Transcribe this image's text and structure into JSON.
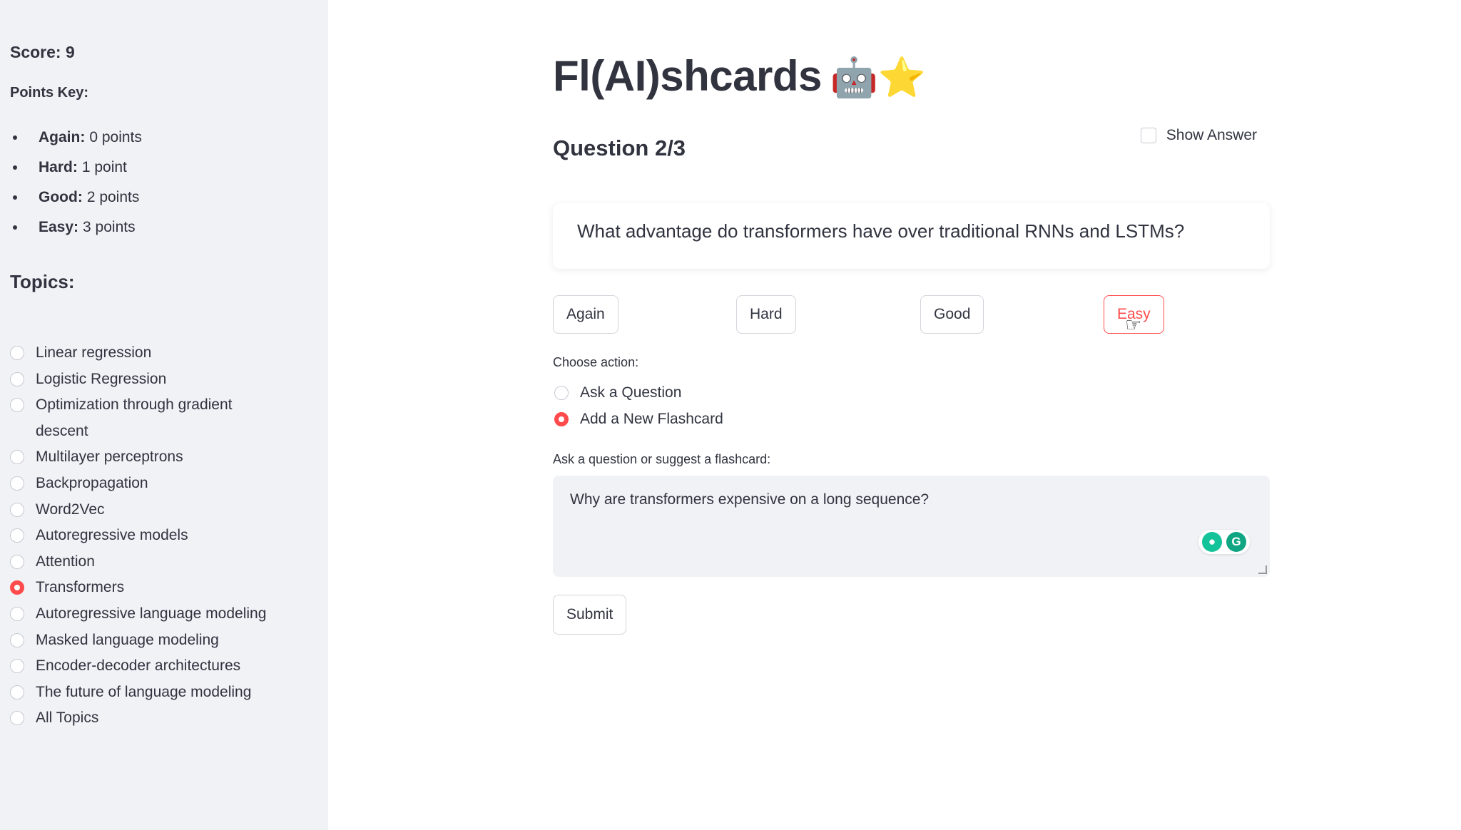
{
  "sidebar": {
    "score": "Score: 9",
    "points_key_title": "Points Key:",
    "points_key": [
      {
        "name": "Again:",
        "value": "0 points"
      },
      {
        "name": "Hard:",
        "value": "1 point"
      },
      {
        "name": "Good:",
        "value": "2 points"
      },
      {
        "name": "Easy:",
        "value": "3 points"
      }
    ],
    "topics_title": "Topics:",
    "topics": [
      {
        "label": "Linear regression",
        "selected": false
      },
      {
        "label": "Logistic Regression",
        "selected": false
      },
      {
        "label": "Optimization through gradient descent",
        "selected": false
      },
      {
        "label": "Multilayer perceptrons",
        "selected": false
      },
      {
        "label": "Backpropagation",
        "selected": false
      },
      {
        "label": "Word2Vec",
        "selected": false
      },
      {
        "label": "Autoregressive models",
        "selected": false
      },
      {
        "label": "Attention",
        "selected": false
      },
      {
        "label": "Transformers",
        "selected": true
      },
      {
        "label": "Autoregressive language modeling",
        "selected": false
      },
      {
        "label": "Masked language modeling",
        "selected": false
      },
      {
        "label": "Encoder-decoder architectures",
        "selected": false
      },
      {
        "label": "The future of language modeling",
        "selected": false
      },
      {
        "label": "All Topics",
        "selected": false
      }
    ]
  },
  "main": {
    "title": "Fl(AI)shcards",
    "title_emoji": "🤖⭐",
    "question_heading": "Question 2/3",
    "show_answer_label": "Show Answer",
    "question_text": "What advantage do transformers have over traditional RNNs and LSTMs?",
    "buttons": {
      "again": "Again",
      "hard": "Hard",
      "good": "Good",
      "easy": "Easy"
    },
    "choose_action_label": "Choose action:",
    "actions": [
      {
        "label": "Ask a Question",
        "selected": false
      },
      {
        "label": "Add a New Flashcard",
        "selected": true
      }
    ],
    "input_label": "Ask a question or suggest a flashcard:",
    "input_value": "Why are transformers expensive on a long sequence?",
    "submit_label": "Submit"
  },
  "colors": {
    "accent": "#ff4b4b",
    "sidebar_bg": "#f0f2f6",
    "text": "#31333f"
  }
}
